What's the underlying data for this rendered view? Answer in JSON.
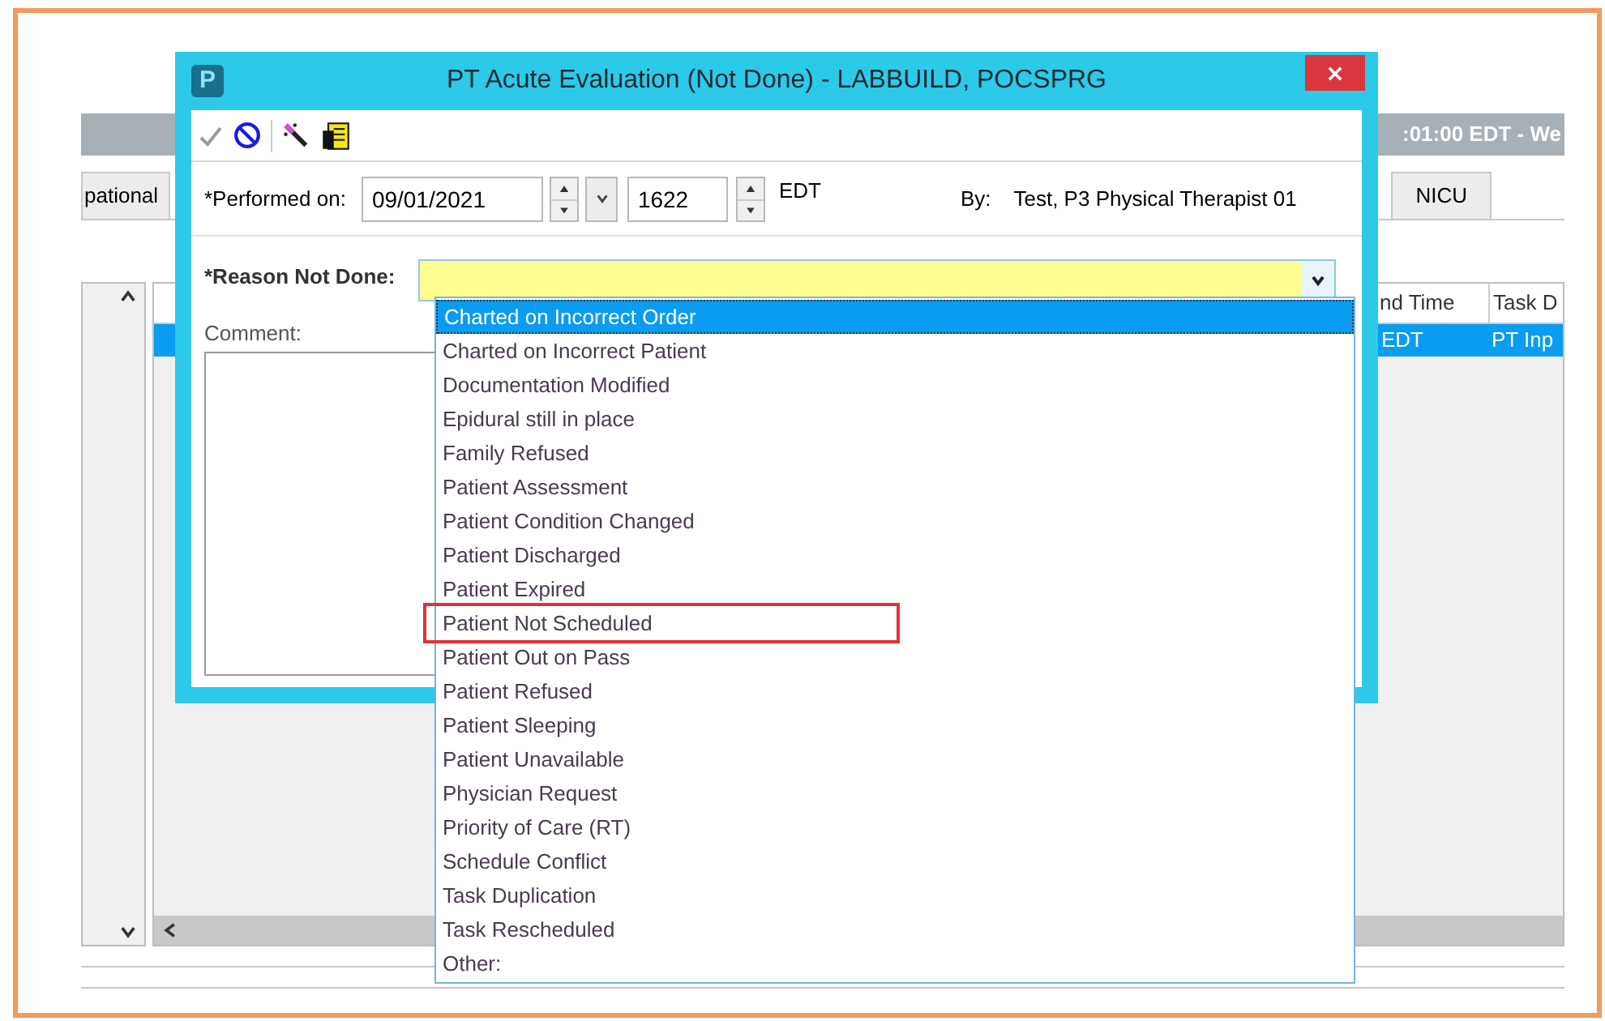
{
  "background": {
    "header_text": ":01:00 EDT - We",
    "tabs": [
      {
        "label": "pational",
        "selected": false
      },
      {
        "label": "NICU",
        "selected": false
      }
    ],
    "table": {
      "columns": [
        "nd Time",
        "Task D"
      ],
      "rows": [
        {
          "cells": [
            "EDT",
            "PT Inp"
          ],
          "selected": true
        }
      ]
    }
  },
  "dialog": {
    "app_icon": "P",
    "title": "PT Acute Evaluation (Not Done) - LABBUILD, POCSPRG",
    "performed_label": "*Performed on:",
    "date": "09/01/2021",
    "time": "1622",
    "timezone": "EDT",
    "by_label": "By:",
    "by_value": "Test, P3 Physical Therapist 01",
    "reason_label": "*Reason Not Done:",
    "comment_label": "Comment:",
    "reason_options": [
      {
        "label": "Charted on Incorrect Order",
        "selected": true,
        "annotated": false
      },
      {
        "label": "Charted on Incorrect Patient",
        "selected": false,
        "annotated": false
      },
      {
        "label": "Documentation Modified",
        "selected": false,
        "annotated": false
      },
      {
        "label": "Epidural still in place",
        "selected": false,
        "annotated": false
      },
      {
        "label": "Family Refused",
        "selected": false,
        "annotated": false
      },
      {
        "label": "Patient Assessment",
        "selected": false,
        "annotated": false
      },
      {
        "label": "Patient Condition Changed",
        "selected": false,
        "annotated": false
      },
      {
        "label": "Patient Discharged",
        "selected": false,
        "annotated": false
      },
      {
        "label": "Patient Expired",
        "selected": false,
        "annotated": false
      },
      {
        "label": "Patient Not Scheduled",
        "selected": false,
        "annotated": true
      },
      {
        "label": "Patient Out on Pass",
        "selected": false,
        "annotated": false
      },
      {
        "label": "Patient Refused",
        "selected": false,
        "annotated": false
      },
      {
        "label": "Patient Sleeping",
        "selected": false,
        "annotated": false
      },
      {
        "label": "Patient Unavailable",
        "selected": false,
        "annotated": false
      },
      {
        "label": "Physician Request",
        "selected": false,
        "annotated": false
      },
      {
        "label": "Priority of Care (RT)",
        "selected": false,
        "annotated": false
      },
      {
        "label": "Schedule Conflict",
        "selected": false,
        "annotated": false
      },
      {
        "label": "Task Duplication",
        "selected": false,
        "annotated": false
      },
      {
        "label": "Task Rescheduled",
        "selected": false,
        "annotated": false
      },
      {
        "label": "Other:",
        "selected": false,
        "annotated": false
      }
    ]
  }
}
